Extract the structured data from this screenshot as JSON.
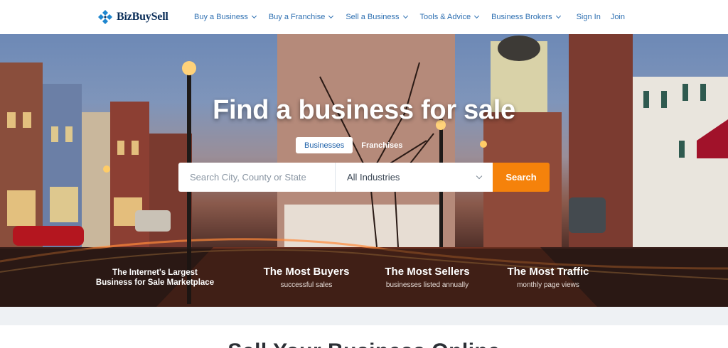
{
  "brand": {
    "name": "BizBuySell"
  },
  "nav": {
    "items": [
      {
        "label": "Buy a Business"
      },
      {
        "label": "Buy a Franchise"
      },
      {
        "label": "Sell a Business"
      },
      {
        "label": "Tools & Advice"
      },
      {
        "label": "Business Brokers"
      }
    ],
    "sign_in": "Sign In",
    "join": "Join"
  },
  "hero": {
    "title": "Find a business for sale",
    "tabs": [
      {
        "label": "Businesses",
        "active": true
      },
      {
        "label": "Franchises",
        "active": false
      }
    ],
    "search": {
      "location_placeholder": "Search City, County or State",
      "industry_selected": "All Industries",
      "button_label": "Search"
    },
    "tagline": {
      "line1": "The Internet's Largest",
      "line2": "Business for Sale Marketplace"
    },
    "stats": [
      {
        "title": "The Most Buyers",
        "subtitle": "successful sales"
      },
      {
        "title": "The Most Sellers",
        "subtitle": "businesses listed annually"
      },
      {
        "title": "The Most Traffic",
        "subtitle": "monthly page views"
      }
    ]
  },
  "section": {
    "heading": "Sell Your Business Online"
  },
  "colors": {
    "link": "#2d6fb1",
    "brand_navy": "#0b2e59",
    "accent_orange": "#f5820b"
  },
  "icons": {
    "logo": "bizbuysell-logo-icon",
    "dropdown": "chevron-down-icon"
  }
}
